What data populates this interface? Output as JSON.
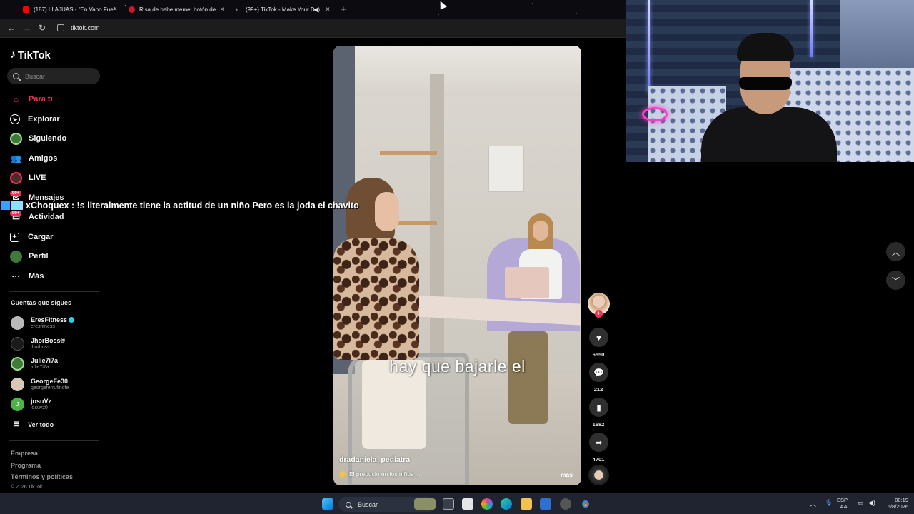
{
  "browser": {
    "tabs": [
      {
        "title": "(187) LLAJUAS - \"En Vano Fue\"",
        "favicon_color": "#ff0000"
      },
      {
        "title": "Risa de bebe meme: botón de",
        "favicon_color": "#cc1a2a"
      },
      {
        "title": "(99+) TikTok - Make Your D",
        "favicon_color": "#ffffff"
      }
    ],
    "url": "tiktok.com"
  },
  "tiktok": {
    "logo": "TikTok",
    "search_placeholder": "Buscar",
    "nav": [
      {
        "label": "Para ti",
        "icon": "home-icon",
        "active": true
      },
      {
        "label": "Explorar",
        "icon": "compass-icon"
      },
      {
        "label": "Siguiendo",
        "icon": "following-avatar-icon"
      },
      {
        "label": "Amigos",
        "icon": "friends-icon"
      },
      {
        "label": "LIVE",
        "icon": "live-icon"
      },
      {
        "label": "Mensajes",
        "icon": "messages-icon",
        "badge": "99+"
      },
      {
        "label": "Actividad",
        "icon": "activity-icon",
        "badge": "99+"
      },
      {
        "label": "Cargar",
        "icon": "upload-icon"
      },
      {
        "label": "Perfil",
        "icon": "profile-avatar-icon"
      },
      {
        "label": "Más",
        "icon": "more-icon"
      }
    ],
    "following_title": "Cuentas que sigues",
    "following": [
      {
        "name": "EresFitness",
        "handle": "eresfitness",
        "verified": true,
        "avatar_color": "#b9b9b9"
      },
      {
        "name": "JhorBoss®",
        "handle": "jhorboss",
        "avatar_color": "#1a1a1a"
      },
      {
        "name": "Julie7i7a",
        "handle": "julie7i7a",
        "avatar_color": "#3f7a3a"
      },
      {
        "name": "GeorgeFe30",
        "handle": "georgeferrufinofe",
        "avatar_color": "#d7c8b8"
      },
      {
        "name": "josuVz",
        "handle": "josuvz0",
        "avatar_color": "#4fb447",
        "initial": "J"
      }
    ],
    "see_all": "Ver todo",
    "footer": [
      "Empresa",
      "Programa",
      "Términos y políticas"
    ],
    "copyright": "© 2026 TikTok"
  },
  "chat_overlay": "xChoquex : !s literalmente tiene la actitud de un niño Pero es la joda el chavito",
  "video": {
    "caption": "hay que bajarle el",
    "author": "dradaniela_pediatra",
    "description": "El prepucio en los niños ...",
    "more": "más",
    "likes": "6550",
    "comments": "212",
    "saves": "1682",
    "shares": "4701"
  },
  "taskbar": {
    "search": "Buscar",
    "lang_top": "ESP",
    "lang_bottom": "LAA",
    "time": "00:19",
    "date": "6/8/2026"
  },
  "colors": {
    "accent": "#fe2c55",
    "background": "#000000"
  }
}
